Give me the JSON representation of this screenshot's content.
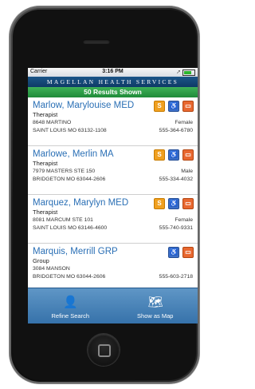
{
  "status_bar": {
    "carrier": "Carrier",
    "time": "3:16 PM"
  },
  "header": {
    "brand": "MAGELLAN HEALTH SERVICES"
  },
  "results_bar": {
    "text": "50 Results Shown"
  },
  "results": [
    {
      "name": "Marlow, Marylouise MED",
      "type": "Therapist",
      "address": "8648 MARTINO",
      "city": "SAINT LOUIS MO 63132-1108",
      "gender": "Female",
      "phone": "555-364-6780"
    },
    {
      "name": "Marlowe, Merlin MA",
      "type": "Therapist",
      "address": "7979 MASTERS STE 150",
      "city": "BRIDGETON MO 63044-2606",
      "gender": "Male",
      "phone": "555-334-4032"
    },
    {
      "name": "Marquez, Marylyn MED",
      "type": "Therapist",
      "address": "8081 MARCUM STE 101",
      "city": "SAINT LOUIS MO 63146-4600",
      "gender": "Female",
      "phone": "555-740-9331"
    },
    {
      "name": "Marquis, Merrill GRP",
      "type": "Group",
      "address": "3084 MANSON",
      "city": "BRIDGETON MO 63044-2606",
      "gender": "",
      "phone": "555-603-2718"
    }
  ],
  "toolbar": {
    "refine_label": "Refine Search",
    "map_label": "Show as Map"
  },
  "icons": {
    "language": "S",
    "accessible": "wheelchair-icon",
    "transit": "bus-icon"
  }
}
